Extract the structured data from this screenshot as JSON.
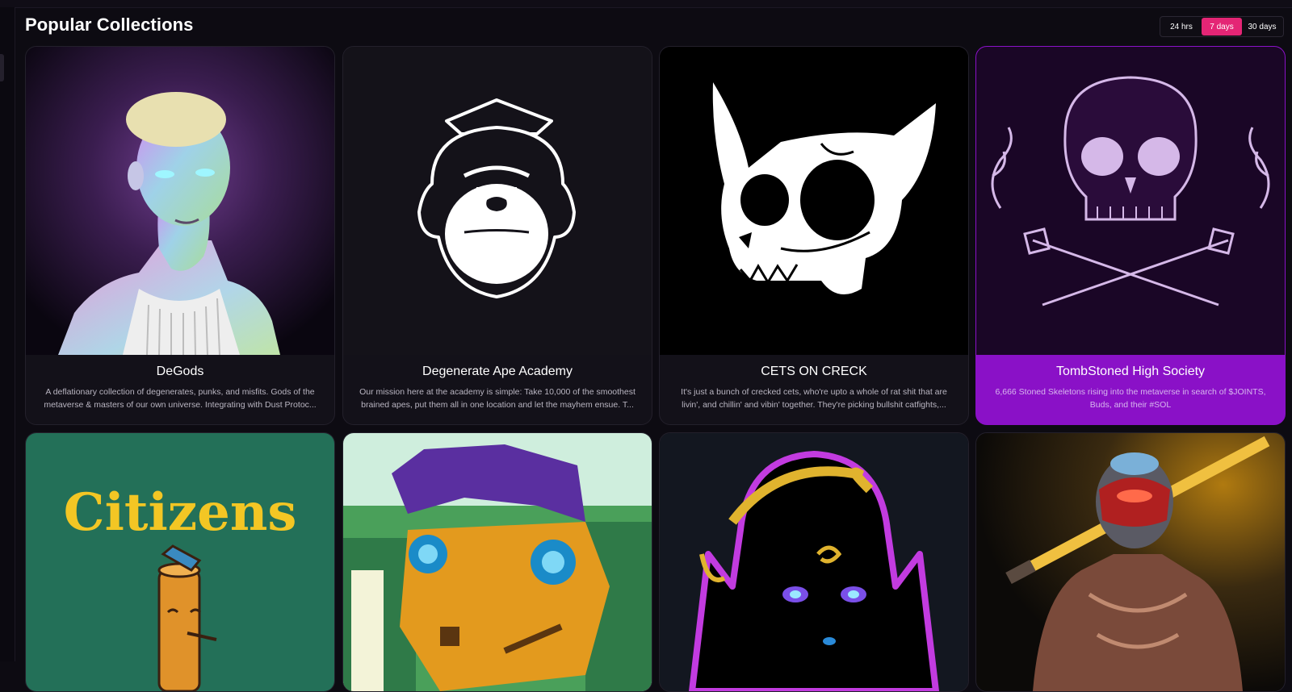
{
  "page": {
    "title": "Popular Collections"
  },
  "time_filter": {
    "options": [
      "24 hrs",
      "7 days",
      "30 days"
    ],
    "selected": "7 days"
  },
  "colors": {
    "accent": "#e42575",
    "highlight_card": "#8a11c7",
    "background": "#0d0b12"
  },
  "collections": [
    {
      "name": "DeGods",
      "description": "A deflationary collection of degenerates, punks, and misfits. Gods of the metaverse & masters of our own universe. Integrating with Dust Protoc...",
      "art_icon": "degod-portrait-icon"
    },
    {
      "name": "Degenerate Ape Academy",
      "description": "Our mission here at the academy is simple: Take 10,000 of the smoothest brained apes, put them all in one location and let the mayhem ensue. T...",
      "art_icon": "ape-head-icon"
    },
    {
      "name": "CETS ON CRECK",
      "description": "It's just a bunch of crecked cets, who're upto a whole of rat shit that are livin', and chillin' and vibin' together. They're picking bullshit catfights,...",
      "art_icon": "cat-skull-icon"
    },
    {
      "name": "TombStoned High Society",
      "description": "6,666 Stoned Skeletons rising into the metaverse in search of $JOINTS, Buds, and their #SOL",
      "art_icon": "skull-crossbones-icon"
    },
    {
      "name": "",
      "description": "",
      "art_text": "Citizens",
      "art_icon": "citizens-stump-icon"
    },
    {
      "name": "",
      "description": "",
      "art_icon": "pixel-lizard-icon"
    },
    {
      "name": "",
      "description": "",
      "art_icon": "neon-silhouette-icon"
    },
    {
      "name": "",
      "description": "",
      "art_icon": "armored-warrior-icon"
    }
  ]
}
